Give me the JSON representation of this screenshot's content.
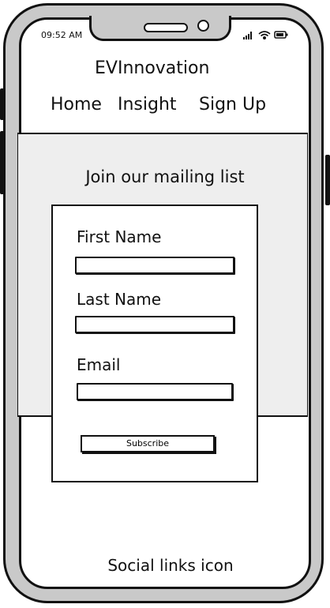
{
  "status_bar": {
    "time": "09:52 AM",
    "icons": [
      "signal-icon",
      "wifi-icon",
      "battery-icon"
    ]
  },
  "header": {
    "title": "EVInnovation"
  },
  "nav": {
    "items": [
      {
        "label": "Home"
      },
      {
        "label": "Insight"
      },
      {
        "label": "Sign Up"
      }
    ]
  },
  "mailing": {
    "heading": "Join our mailing list",
    "fields": [
      {
        "label": "First Name",
        "value": "",
        "placeholder": ""
      },
      {
        "label": "Last Name",
        "value": "",
        "placeholder": ""
      },
      {
        "label": "Email",
        "value": "",
        "placeholder": ""
      }
    ],
    "submit_label": "Subscribe"
  },
  "footer": {
    "social_links": "Social links icon"
  },
  "colors": {
    "frame": "#c9c9c9",
    "outline": "#111111",
    "section_bg": "#eeeeee"
  }
}
